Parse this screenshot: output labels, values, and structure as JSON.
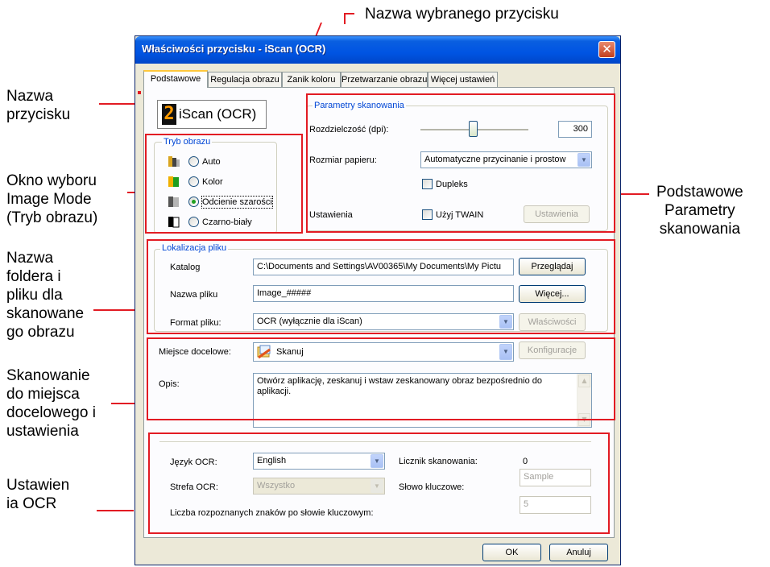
{
  "annotations": {
    "top": "Nazwa wybranego przycisku",
    "button_name": [
      "Nazwa",
      "przycisku"
    ],
    "image_mode": [
      "Okno wyboru",
      "Image Mode",
      "(Tryb obrazu)"
    ],
    "folder": [
      "Nazwa",
      "foldera i",
      "pliku dla",
      "skanowane",
      "go obrazu"
    ],
    "destination": [
      "Skanowanie",
      "do miejsca",
      "docelowego i",
      "ustawienia"
    ],
    "ocr": [
      "Ustawien",
      "ia OCR"
    ],
    "basic_params": [
      "Podstawowe",
      "Parametry",
      "skanowania"
    ]
  },
  "window": {
    "title": "Właściwości przycisku - iScan (OCR)"
  },
  "tabs": [
    {
      "label": "Podstawowe",
      "active": true
    },
    {
      "label": "Regulacja obrazu"
    },
    {
      "label": "Zanik koloru"
    },
    {
      "label": "Przetwarzanie obrazu"
    },
    {
      "label": "Więcej ustawień"
    }
  ],
  "button_name": {
    "icon_digit": "2",
    "name": "iScan (OCR)"
  },
  "image_mode": {
    "title": "Tryb obrazu",
    "options": [
      {
        "label": "Auto",
        "selected": false
      },
      {
        "label": "Kolor",
        "selected": false
      },
      {
        "label": "Odcienie szarości",
        "selected": true
      },
      {
        "label": "Czarno-biały",
        "selected": false
      }
    ]
  },
  "scan_params": {
    "title": "Parametry skanowania",
    "resolution_label": "Rozdzielczość (dpi):",
    "resolution_value": "300",
    "paper_label": "Rozmiar papieru:",
    "paper_value": "Automatyczne przycinanie i prostow",
    "duplex_label": "Dupleks",
    "duplex_checked": false,
    "settings_label": "Ustawienia",
    "twain_label": "Użyj TWAIN",
    "twain_checked": false,
    "settings_button": "Ustawienia"
  },
  "file_location": {
    "title": "Lokalizacja pliku",
    "folder_label": "Katalog",
    "folder_value": "C:\\Documents and Settings\\AV00365\\My Documents\\My Pictu",
    "browse_button": "Przeglądaj",
    "filename_label": "Nazwa pliku",
    "filename_value": "Image_#####",
    "more_button": "Więcej...",
    "format_label": "Format pliku:",
    "format_value": "OCR (wyłącznie dla iScan)",
    "properties_button": "Właściwości"
  },
  "destination": {
    "label": "Miejsce docelowe:",
    "value": "Skanuj",
    "config_button": "Konfiguracje",
    "desc_label": "Opis:",
    "desc_value": "Otwórz aplikację, zeskanuj i wstaw zeskanowany obraz bezpośrednio do aplikacji."
  },
  "ocr": {
    "language_label": "Język OCR:",
    "language_value": "English",
    "zone_label": "Strefa OCR:",
    "zone_value": "Wszystko",
    "counter_label": "Licznik skanowania:",
    "counter_value": "0",
    "keyword_label": "Słowo kluczowe:",
    "keyword_value": "Sample",
    "chars_label": "Liczba rozpoznanych znaków po słowie kluczowym:",
    "chars_value": "5"
  },
  "footer": {
    "ok": "OK",
    "cancel": "Anuluj"
  },
  "colors": {
    "annotation_red": "#e21b23",
    "title_blue": "#0054e3",
    "group_title": "#0046d5"
  }
}
